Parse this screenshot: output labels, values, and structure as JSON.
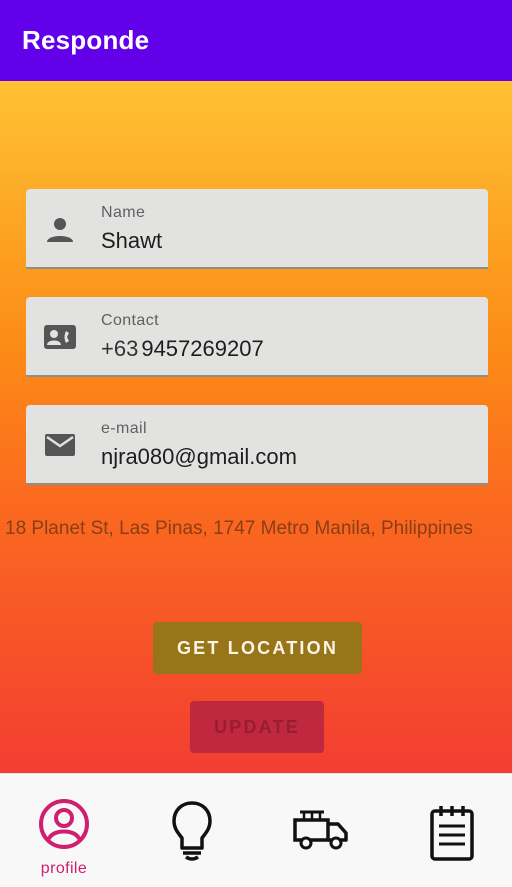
{
  "app": {
    "title": "Responde"
  },
  "colors": {
    "app_bar": "#6200ea",
    "gradient_top": "#fec234",
    "gradient_bottom": "#f33d32",
    "field_bg": "#e2e3e1",
    "location_button": "#997519",
    "update_button": "#ae1f44",
    "nav_active": "#cf1f6e"
  },
  "form": {
    "name": {
      "label": "Name",
      "value": "Shawt",
      "icon": "person-icon"
    },
    "contact": {
      "label": "Contact",
      "prefix": "+63",
      "value": "9457269207",
      "icon": "contact-card-icon"
    },
    "email": {
      "label": "e-mail",
      "value": "njra080@gmail.com",
      "icon": "mail-icon"
    }
  },
  "address": "18 Planet St, Las Pinas, 1747 Metro Manila, Philippines",
  "buttons": {
    "get_location": "GET LOCATION",
    "update": "UPDATE"
  },
  "nav": {
    "items": [
      {
        "label": "profile",
        "icon": "profile-icon",
        "active": true
      },
      {
        "label": "",
        "icon": "lightbulb-icon",
        "active": false
      },
      {
        "label": "",
        "icon": "fire-truck-icon",
        "active": false
      },
      {
        "label": "",
        "icon": "notepad-icon",
        "active": false
      }
    ]
  }
}
